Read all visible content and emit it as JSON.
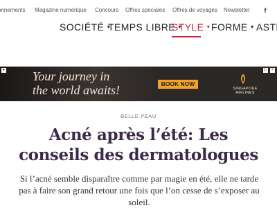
{
  "top_nav": {
    "items": [
      "onnements",
      "Magazine numérique",
      "Concours",
      "Offres spéciales",
      "Offres de voyages",
      "Newsletter"
    ],
    "social_label": "f"
  },
  "main_nav": {
    "items": [
      {
        "label": "SOCIÉTÉ",
        "active": false
      },
      {
        "label": "TEMPS LIBRE",
        "active": false
      },
      {
        "label": "STYLE",
        "active": true
      },
      {
        "label": "FORME",
        "active": false
      },
      {
        "label": "ASTRO",
        "active": false
      }
    ],
    "active_color": "#cc2045"
  },
  "ad": {
    "headline_line1": "Your journey in",
    "headline_line2": "the world awaits!",
    "cta": "BOOK NOW",
    "brand_line1": "SINGAPORE",
    "brand_line2": "AIRLINES",
    "accent": "#f2a326"
  },
  "article": {
    "category": "BELLE PEAU",
    "title": "Acné après l’été: Les conseils des dermatologues",
    "lede": "Si l’acné semble disparaître comme par magie en été, elle ne tarde pas à faire son grand retour une fois que l’on cesse de s’exposer au soleil."
  }
}
